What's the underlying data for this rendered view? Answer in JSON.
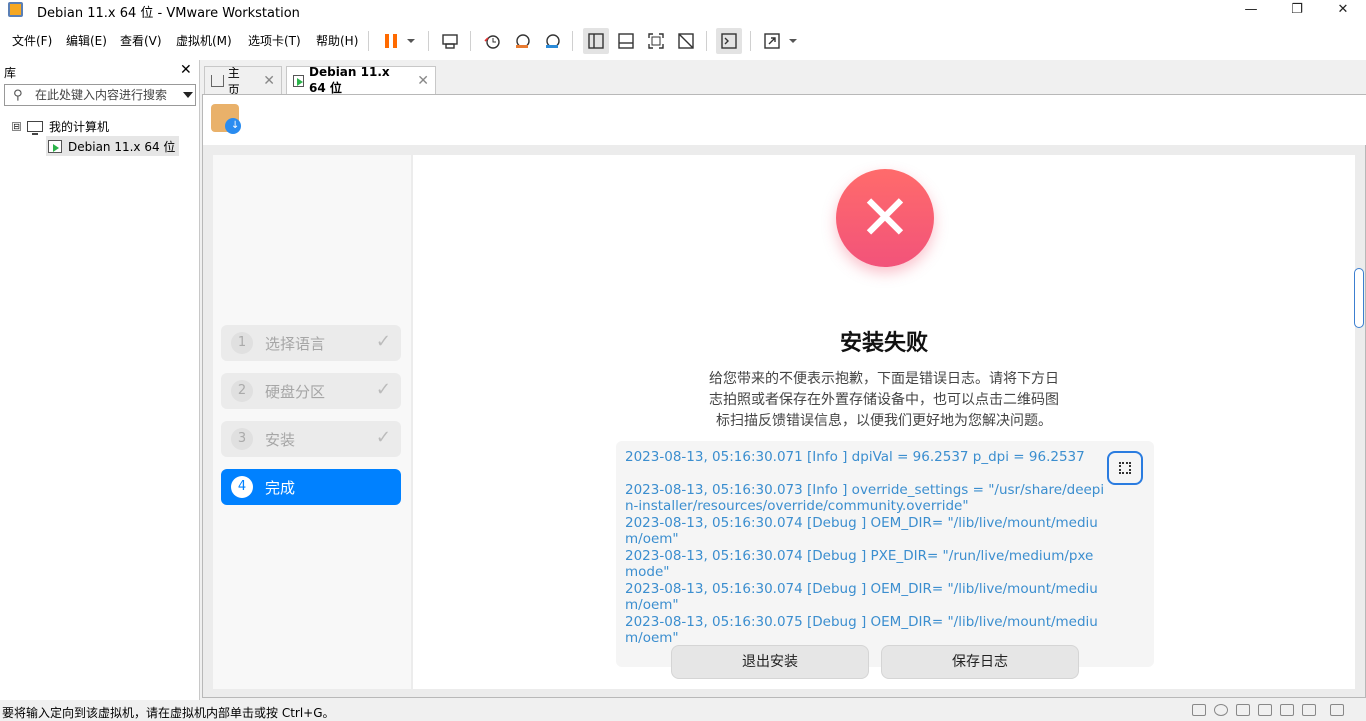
{
  "window": {
    "title": "Debian 11.x 64 位 - VMware Workstation",
    "minimize": "—",
    "restore": "❐",
    "close": "✕"
  },
  "menu": [
    "文件(F)",
    "编辑(E)",
    "查看(V)",
    "虚拟机(M)",
    "选项卡(T)",
    "帮助(H)"
  ],
  "toolbar": {
    "icons": [
      "pause-icon",
      "dropdown-icon",
      "send-keys-icon",
      "snapshot-icon",
      "revert-snapshot-icon",
      "snapshot-manager-icon",
      "library-view-icon",
      "thumbnail-view-icon",
      "fullscreen-icon",
      "unity-icon",
      "console-icon",
      "stretch-icon",
      "dropdown-icon"
    ],
    "pause_color": "#ff6a00"
  },
  "library": {
    "title": "库",
    "close": "✕",
    "search_placeholder": "在此处键入内容进行搜索",
    "root": "我的计算机",
    "root_toggle": "⊟",
    "vm": "Debian 11.x 64 位"
  },
  "tabs": [
    {
      "label": "主页",
      "close": "✕"
    },
    {
      "label": "Debian 11.x 64 位",
      "close": "✕"
    }
  ],
  "installer": {
    "steps": [
      {
        "num": "1",
        "label": "选择语言",
        "check": "✓"
      },
      {
        "num": "2",
        "label": "硬盘分区",
        "check": "✓"
      },
      {
        "num": "3",
        "label": "安装",
        "check": "✓"
      },
      {
        "num": "4",
        "label": "完成",
        "check": ""
      }
    ],
    "fail_symbol": "✕",
    "title": "安装失败",
    "description": "给您带来的不便表示抱歉，下面是错误日志。请将下方日志拍照或者保存在外置存储设备中，也可以点击二维码图标扫描反馈错误信息，以便我们更好地为您解决问题。",
    "log": [
      "2023-08-13, 05:16:30.071 [Info   ] dpiVal =  96.2537 p_dpi =  96.2537",
      "",
      "2023-08-13, 05:16:30.073 [Info   ] override_settings =  \"/usr/share/deepin-installer/resources/override/community.override\"",
      "2023-08-13, 05:16:30.074 [Debug  ] OEM_DIR= \"/lib/live/mount/medium/oem\"",
      "2023-08-13, 05:16:30.074 [Debug  ] PXE_DIR= \"/run/live/medium/pxemode\"",
      "2023-08-13, 05:16:30.074 [Debug  ] OEM_DIR= \"/lib/live/mount/medium/oem\"",
      "2023-08-13, 05:16:30.075 [Debug  ] OEM_DIR= \"/lib/live/mount/medium/oem\""
    ],
    "buttons": {
      "exit": "退出安装",
      "save_log": "保存日志"
    },
    "accent": "#0081ff",
    "log_color": "#3b8ecf"
  },
  "status": {
    "text": "要将输入定向到该虚拟机，请在虚拟机内部单击或按 Ctrl+G。",
    "icons": [
      "hdd-icon",
      "cd-icon",
      "network-icon",
      "usb-icon",
      "printer-icon",
      "sound-icon",
      "display-icon",
      "message-icon"
    ]
  }
}
